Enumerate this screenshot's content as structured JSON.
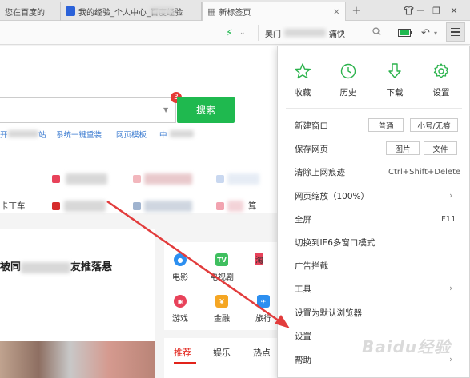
{
  "tabs": [
    {
      "label": "您在百度的"
    },
    {
      "label": "我的经验_个人中心_百度经验"
    },
    {
      "label": "新标签页",
      "close": "×"
    }
  ],
  "window_controls": {
    "new_tab": "+",
    "minimize": "−",
    "restore": "❐",
    "close": "✕"
  },
  "toolbar": {
    "search_value": "奥门",
    "search_tail": "痛快",
    "zoom_icon": "⌄"
  },
  "page": {
    "search_button": "搜索",
    "badge_count": "3",
    "quick_links": [
      "开",
      "站",
      "系统一键重装",
      "网页模板",
      "中"
    ],
    "sites": [
      "卡丁车",
      "算"
    ],
    "news_title_left": "被同",
    "news_title_right": "友推落悬",
    "apps": [
      "电影",
      "电视剧",
      "游戏",
      "金融",
      "旅行"
    ],
    "feed_tabs": [
      "推荐",
      "娱乐",
      "热点"
    ]
  },
  "menu": {
    "quick_actions": [
      "收藏",
      "历史",
      "下载",
      "设置"
    ],
    "items": [
      {
        "label": "新建窗口"
      },
      {
        "label": "保存网页"
      },
      {
        "label": "清除上网痕迹"
      },
      {
        "label": "网页缩放（100%）"
      },
      {
        "label": "全屏"
      },
      {
        "label": "切换到IE6多窗口模式"
      },
      {
        "label": "广告拦截"
      },
      {
        "label": "工具"
      },
      {
        "label": "设置为默认浏览器"
      },
      {
        "label": "设置"
      },
      {
        "label": "帮助"
      }
    ],
    "new_window_normal": "普通",
    "new_window_private": "小号/无痕",
    "save_image": "图片",
    "save_file": "文件",
    "clear_shortcut": "Ctrl+Shift+Delete",
    "fullscreen_shortcut": "F11"
  },
  "watermark": "Baidu经验",
  "colors": {
    "accent_green": "#1fb94f",
    "badge_red": "#e53935",
    "arrow_red": "#e23c3c"
  }
}
